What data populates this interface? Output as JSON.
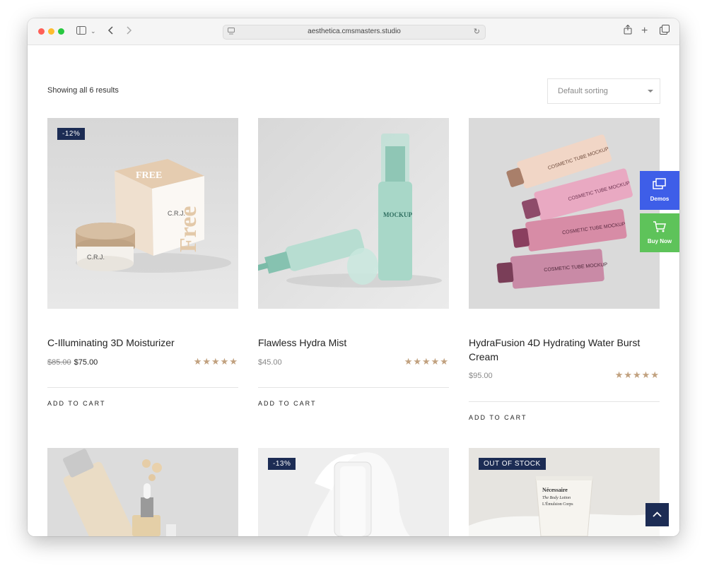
{
  "browser": {
    "url": "aesthetica.cmsmasters.studio"
  },
  "toolbar_icons": {
    "sidebar": "sidebar-icon",
    "chevron": "chevron-down-icon",
    "back": "back-arrow-icon",
    "forward": "forward-arrow-icon",
    "reload": "reload-icon",
    "share": "share-icon",
    "new_tab": "plus-icon",
    "tabs": "tabs-icon"
  },
  "shop": {
    "results_text": "Showing all 6 results",
    "sorting": "Default sorting",
    "add_to_cart": "ADD TO CART"
  },
  "products": [
    {
      "title": "C-Illuminating 3D Moisturizer",
      "old_price": "$85.00",
      "price": "$75.00",
      "badge": "-12%",
      "stars": "★★★★★"
    },
    {
      "title": "Flawless Hydra Mist",
      "price": "$45.00",
      "stars": "★★★★★"
    },
    {
      "title": "HydraFusion 4D Hydrating Water Burst Cream",
      "price": "$95.00",
      "stars": "★★★★★"
    },
    {
      "badge": ""
    },
    {
      "badge": "-13%"
    },
    {
      "badge": "OUT OF STOCK"
    }
  ],
  "product_images": {
    "jar_box": {
      "box_text": "FREE",
      "jar_text": "C.R.J.",
      "side_text": "Free"
    },
    "spray": {
      "bottle_text": "MOCKUP"
    },
    "tubes": {
      "tube_text": "COSMETIC TUBE MOCKUP"
    },
    "lotion": {
      "line1": "Nécessaire",
      "line2": "The Body Lotion",
      "line3": "L'Émulsion Corps"
    }
  },
  "side_buttons": {
    "demos": "Demos",
    "buy": "Buy Now"
  },
  "colors": {
    "badge": "#1c2c54",
    "stars": "#c1a17f",
    "demos": "#3e5ee8",
    "buy": "#5ec35a"
  }
}
